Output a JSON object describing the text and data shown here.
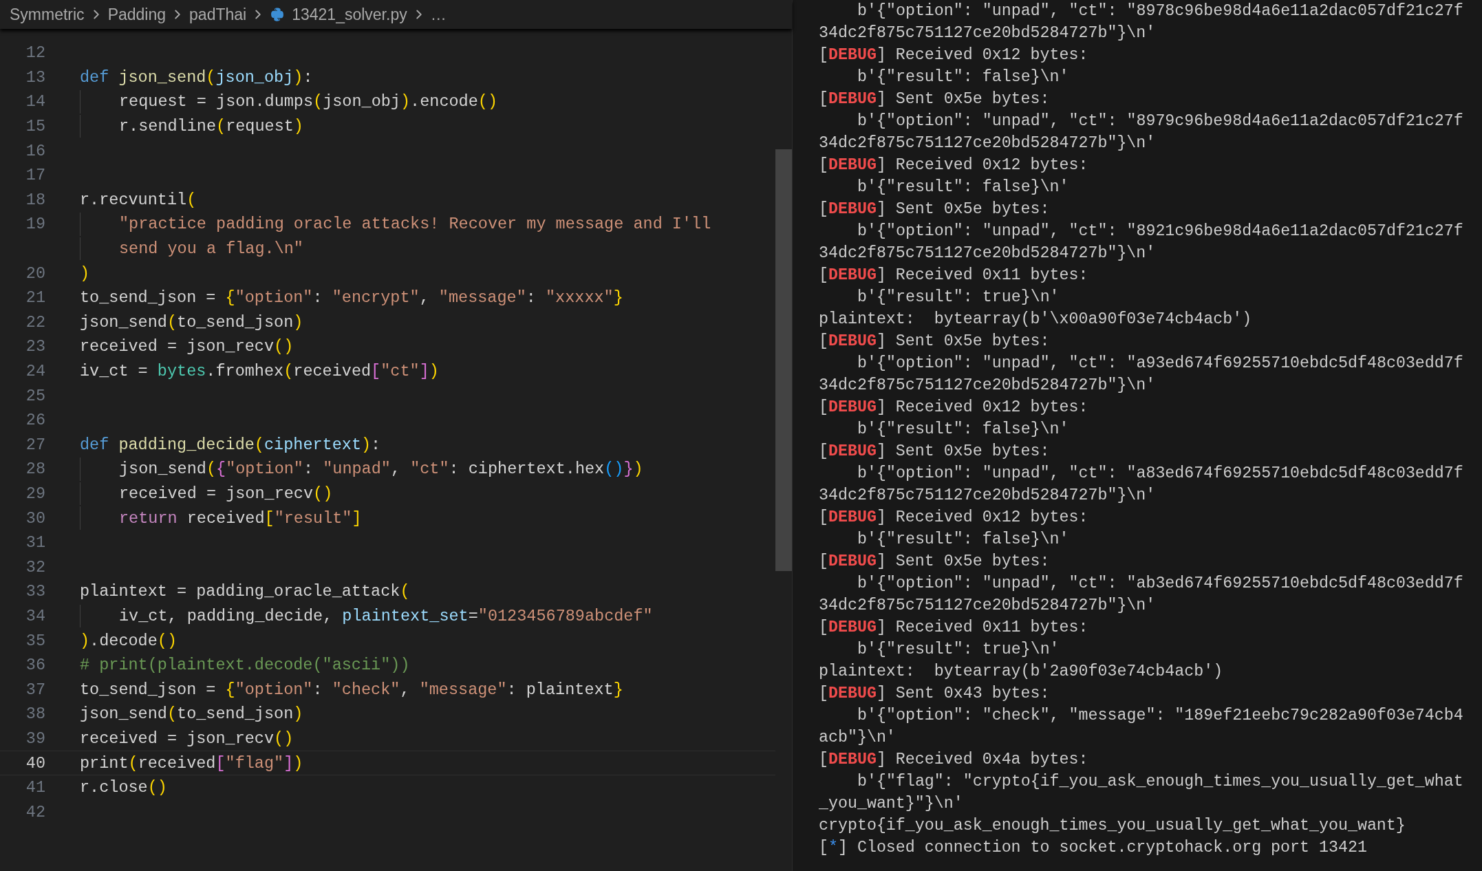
{
  "breadcrumb": [
    {
      "label": "Symmetric",
      "kind": "folder"
    },
    {
      "label": "Padding",
      "kind": "folder"
    },
    {
      "label": "padThai",
      "kind": "folder"
    },
    {
      "label": "13421_solver.py",
      "kind": "file"
    },
    {
      "label": "…",
      "kind": "more"
    }
  ],
  "code": [
    {
      "number": "12",
      "current": false
    },
    {
      "number": "13",
      "current": false,
      "tokens": [
        {
          "text": "def",
          "kind": "kw"
        },
        {
          "text": " json_send",
          "kind": "fn"
        },
        {
          "text": "(",
          "kind": "b1"
        },
        {
          "text": "json_obj",
          "kind": "par"
        },
        {
          "text": ")",
          "kind": "b1"
        },
        {
          "text": ":",
          "kind": "p"
        }
      ],
      "children": [
        {
          "number": "14",
          "current": false,
          "tokens": [
            {
              "text": "request = json.dumps",
              "kind": "p"
            },
            {
              "text": "(",
              "kind": "b1"
            },
            {
              "text": "json_obj",
              "kind": "p"
            },
            {
              "text": ")",
              "kind": "b1"
            },
            {
              "text": ".encode",
              "kind": "p"
            },
            {
              "text": "()",
              "kind": "b1"
            }
          ]
        },
        {
          "number": "15",
          "current": false,
          "tokens": [
            {
              "text": "r.sendline",
              "kind": "p"
            },
            {
              "text": "(",
              "kind": "b1"
            },
            {
              "text": "request",
              "kind": "p"
            },
            {
              "text": ")",
              "kind": "b1"
            }
          ]
        }
      ]
    },
    {
      "number": "16",
      "current": false
    },
    {
      "number": "17",
      "current": false
    },
    {
      "number": "18",
      "current": false,
      "tokens": [
        {
          "text": "r.recvuntil",
          "kind": "p"
        },
        {
          "text": "(",
          "kind": "b1"
        }
      ],
      "children": [
        {
          "number": "19",
          "current": false,
          "tokens": [
            {
              "text": "\"practice padding oracle attacks! Recover my message and I'll",
              "kind": "str"
            }
          ],
          "wrap": [
            {
              "text": "send you a flag.\\n\"",
              "kind": "str"
            }
          ]
        }
      ]
    },
    {
      "number": "20",
      "current": false,
      "tokens": [
        {
          "text": ")",
          "kind": "b1"
        }
      ]
    },
    {
      "number": "21",
      "current": false,
      "tokens": [
        {
          "text": "to_send_json = ",
          "kind": "p"
        },
        {
          "text": "{",
          "kind": "b1"
        },
        {
          "text": "\"option\"",
          "kind": "str"
        },
        {
          "text": ": ",
          "kind": "p"
        },
        {
          "text": "\"encrypt\"",
          "kind": "str"
        },
        {
          "text": ", ",
          "kind": "p"
        },
        {
          "text": "\"message\"",
          "kind": "str"
        },
        {
          "text": ": ",
          "kind": "p"
        },
        {
          "text": "\"xxxxx\"",
          "kind": "str"
        },
        {
          "text": "}",
          "kind": "b1"
        }
      ]
    },
    {
      "number": "22",
      "current": false,
      "tokens": [
        {
          "text": "json_send",
          "kind": "p"
        },
        {
          "text": "(",
          "kind": "b1"
        },
        {
          "text": "to_send_json",
          "kind": "p"
        },
        {
          "text": ")",
          "kind": "b1"
        }
      ]
    },
    {
      "number": "23",
      "current": false,
      "tokens": [
        {
          "text": "received = json_recv",
          "kind": "p"
        },
        {
          "text": "()",
          "kind": "b1"
        }
      ]
    },
    {
      "number": "24",
      "current": false,
      "tokens": [
        {
          "text": "iv_ct = ",
          "kind": "p"
        },
        {
          "text": "bytes",
          "kind": "bi"
        },
        {
          "text": ".fromhex",
          "kind": "p"
        },
        {
          "text": "(",
          "kind": "b1"
        },
        {
          "text": "received",
          "kind": "p"
        },
        {
          "text": "[",
          "kind": "b2"
        },
        {
          "text": "\"ct\"",
          "kind": "str"
        },
        {
          "text": "]",
          "kind": "b2"
        },
        {
          "text": ")",
          "kind": "b1"
        }
      ]
    },
    {
      "number": "25",
      "current": false
    },
    {
      "number": "26",
      "current": false
    },
    {
      "number": "27",
      "current": false,
      "tokens": [
        {
          "text": "def",
          "kind": "kw"
        },
        {
          "text": " padding_decide",
          "kind": "fn"
        },
        {
          "text": "(",
          "kind": "b1"
        },
        {
          "text": "ciphertext",
          "kind": "par"
        },
        {
          "text": ")",
          "kind": "b1"
        },
        {
          "text": ":",
          "kind": "p"
        }
      ],
      "children": [
        {
          "number": "28",
          "current": false,
          "tokens": [
            {
              "text": "json_send",
              "kind": "p"
            },
            {
              "text": "(",
              "kind": "b1"
            },
            {
              "text": "{",
              "kind": "b2"
            },
            {
              "text": "\"option\"",
              "kind": "str"
            },
            {
              "text": ": ",
              "kind": "p"
            },
            {
              "text": "\"unpad\"",
              "kind": "str"
            },
            {
              "text": ", ",
              "kind": "p"
            },
            {
              "text": "\"ct\"",
              "kind": "str"
            },
            {
              "text": ": ciphertext.hex",
              "kind": "p"
            },
            {
              "text": "()",
              "kind": "b3"
            },
            {
              "text": "}",
              "kind": "b2"
            },
            {
              "text": ")",
              "kind": "b1"
            }
          ]
        },
        {
          "number": "29",
          "current": false,
          "tokens": [
            {
              "text": "received = json_recv",
              "kind": "p"
            },
            {
              "text": "()",
              "kind": "b1"
            }
          ]
        },
        {
          "number": "30",
          "current": false,
          "tokens": [
            {
              "text": "return",
              "kind": "ctl"
            },
            {
              "text": " received",
              "kind": "p"
            },
            {
              "text": "[",
              "kind": "b1"
            },
            {
              "text": "\"result\"",
              "kind": "str"
            },
            {
              "text": "]",
              "kind": "b1"
            }
          ]
        }
      ]
    },
    {
      "number": "31",
      "current": false
    },
    {
      "number": "32",
      "current": false
    },
    {
      "number": "33",
      "current": false,
      "tokens": [
        {
          "text": "plaintext = padding_oracle_attack",
          "kind": "p"
        },
        {
          "text": "(",
          "kind": "b1"
        }
      ],
      "children": [
        {
          "number": "34",
          "current": false,
          "tokens": [
            {
              "text": "iv_ct, padding_decide, ",
              "kind": "p"
            },
            {
              "text": "plaintext_set",
              "kind": "par"
            },
            {
              "text": "=",
              "kind": "p"
            },
            {
              "text": "\"0123456789abcdef\"",
              "kind": "str"
            }
          ]
        }
      ]
    },
    {
      "number": "35",
      "current": false,
      "tokens": [
        {
          "text": ")",
          "kind": "b1"
        },
        {
          "text": ".decode",
          "kind": "p"
        },
        {
          "text": "()",
          "kind": "b1"
        }
      ]
    },
    {
      "number": "36",
      "current": false,
      "tokens": [
        {
          "text": "# print(plaintext.decode(\"ascii\"))",
          "kind": "cm"
        }
      ]
    },
    {
      "number": "37",
      "current": false,
      "tokens": [
        {
          "text": "to_send_json = ",
          "kind": "p"
        },
        {
          "text": "{",
          "kind": "b1"
        },
        {
          "text": "\"option\"",
          "kind": "str"
        },
        {
          "text": ": ",
          "kind": "p"
        },
        {
          "text": "\"check\"",
          "kind": "str"
        },
        {
          "text": ", ",
          "kind": "p"
        },
        {
          "text": "\"message\"",
          "kind": "str"
        },
        {
          "text": ": plaintext",
          "kind": "p"
        },
        {
          "text": "}",
          "kind": "b1"
        }
      ]
    },
    {
      "number": "38",
      "current": false,
      "tokens": [
        {
          "text": "json_send",
          "kind": "p"
        },
        {
          "text": "(",
          "kind": "b1"
        },
        {
          "text": "to_send_json",
          "kind": "p"
        },
        {
          "text": ")",
          "kind": "b1"
        }
      ]
    },
    {
      "number": "39",
      "current": false,
      "tokens": [
        {
          "text": "received = json_recv",
          "kind": "p"
        },
        {
          "text": "()",
          "kind": "b1"
        }
      ]
    },
    {
      "number": "40",
      "current": true,
      "tokens": [
        {
          "text": "print",
          "kind": "p"
        },
        {
          "text": "(",
          "kind": "b1"
        },
        {
          "text": "received",
          "kind": "p"
        },
        {
          "text": "[",
          "kind": "b2"
        },
        {
          "text": "\"flag\"",
          "kind": "str"
        },
        {
          "text": "]",
          "kind": "b2"
        },
        {
          "text": ")",
          "kind": "b1"
        }
      ]
    },
    {
      "number": "41",
      "current": false,
      "tokens": [
        {
          "text": "r.close",
          "kind": "p"
        },
        {
          "text": "()",
          "kind": "b1"
        }
      ]
    },
    {
      "number": "42",
      "current": false
    }
  ],
  "terminal": [
    {
      "kind": "data",
      "parts": [
        "b'{\"option\": \"unpad\", \"ct\": \"8978c96be98d4a6e11a2dac057df21c27f"
      ]
    },
    {
      "kind": "wrap",
      "parts": [
        "34dc2f875c751127ce20bd5284727b\"}\\n'"
      ]
    },
    {
      "kind": "debug",
      "parts": [
        "[",
        "DEBUG",
        "] Received 0x12 bytes:"
      ]
    },
    {
      "kind": "data",
      "parts": [
        "b'{\"result\": false}\\n'"
      ]
    },
    {
      "kind": "debug",
      "parts": [
        "[",
        "DEBUG",
        "] Sent 0x5e bytes:"
      ]
    },
    {
      "kind": "data",
      "parts": [
        "b'{\"option\": \"unpad\", \"ct\": \"8979c96be98d4a6e11a2dac057df21c27f"
      ]
    },
    {
      "kind": "wrap",
      "parts": [
        "34dc2f875c751127ce20bd5284727b\"}\\n'"
      ]
    },
    {
      "kind": "debug",
      "parts": [
        "[",
        "DEBUG",
        "] Received 0x12 bytes:"
      ]
    },
    {
      "kind": "data",
      "parts": [
        "b'{\"result\": false}\\n'"
      ]
    },
    {
      "kind": "debug",
      "parts": [
        "[",
        "DEBUG",
        "] Sent 0x5e bytes:"
      ]
    },
    {
      "kind": "data",
      "parts": [
        "b'{\"option\": \"unpad\", \"ct\": \"8921c96be98d4a6e11a2dac057df21c27f"
      ]
    },
    {
      "kind": "wrap",
      "parts": [
        "34dc2f875c751127ce20bd5284727b\"}\\n'"
      ]
    },
    {
      "kind": "debug",
      "parts": [
        "[",
        "DEBUG",
        "] Received 0x11 bytes:"
      ]
    },
    {
      "kind": "data",
      "parts": [
        "b'{\"result\": true}\\n'"
      ]
    },
    {
      "kind": "plain",
      "parts": [
        "plaintext:  bytearray(b'\\x00a90f03e74cb4acb')"
      ]
    },
    {
      "kind": "debug",
      "parts": [
        "[",
        "DEBUG",
        "] Sent 0x5e bytes:"
      ]
    },
    {
      "kind": "data",
      "parts": [
        "b'{\"option\": \"unpad\", \"ct\": \"a93ed674f69255710ebdc5df48c03edd7f"
      ]
    },
    {
      "kind": "wrap",
      "parts": [
        "34dc2f875c751127ce20bd5284727b\"}\\n'"
      ]
    },
    {
      "kind": "debug",
      "parts": [
        "[",
        "DEBUG",
        "] Received 0x12 bytes:"
      ]
    },
    {
      "kind": "data",
      "parts": [
        "b'{\"result\": false}\\n'"
      ]
    },
    {
      "kind": "debug",
      "parts": [
        "[",
        "DEBUG",
        "] Sent 0x5e bytes:"
      ]
    },
    {
      "kind": "data",
      "parts": [
        "b'{\"option\": \"unpad\", \"ct\": \"a83ed674f69255710ebdc5df48c03edd7f"
      ]
    },
    {
      "kind": "wrap",
      "parts": [
        "34dc2f875c751127ce20bd5284727b\"}\\n'"
      ]
    },
    {
      "kind": "debug",
      "parts": [
        "[",
        "DEBUG",
        "] Received 0x12 bytes:"
      ]
    },
    {
      "kind": "data",
      "parts": [
        "b'{\"result\": false}\\n'"
      ]
    },
    {
      "kind": "debug",
      "parts": [
        "[",
        "DEBUG",
        "] Sent 0x5e bytes:"
      ]
    },
    {
      "kind": "data",
      "parts": [
        "b'{\"option\": \"unpad\", \"ct\": \"ab3ed674f69255710ebdc5df48c03edd7f"
      ]
    },
    {
      "kind": "wrap",
      "parts": [
        "34dc2f875c751127ce20bd5284727b\"}\\n'"
      ]
    },
    {
      "kind": "debug",
      "parts": [
        "[",
        "DEBUG",
        "] Received 0x11 bytes:"
      ]
    },
    {
      "kind": "data",
      "parts": [
        "b'{\"result\": true}\\n'"
      ]
    },
    {
      "kind": "plain",
      "parts": [
        "plaintext:  bytearray(b'2a90f03e74cb4acb')"
      ]
    },
    {
      "kind": "debug",
      "parts": [
        "[",
        "DEBUG",
        "] Sent 0x43 bytes:"
      ]
    },
    {
      "kind": "data",
      "parts": [
        "b'{\"option\": \"check\", \"message\": \"189ef21eebc79c282a90f03e74cb4"
      ]
    },
    {
      "kind": "wrap",
      "parts": [
        "acb\"}\\n'"
      ]
    },
    {
      "kind": "debug",
      "parts": [
        "[",
        "DEBUG",
        "] Received 0x4a bytes:"
      ]
    },
    {
      "kind": "data",
      "parts": [
        "b'{\"flag\": \"crypto{if_you_ask_enough_times_you_usually_get_what"
      ]
    },
    {
      "kind": "wrap",
      "parts": [
        "_you_want}\"}\\n'"
      ]
    },
    {
      "kind": "plain",
      "parts": [
        "crypto{if_you_ask_enough_times_you_usually_get_what_you_want}"
      ]
    },
    {
      "kind": "info",
      "parts": [
        "[",
        "*",
        "] Closed connection to socket.cryptohack.org port 13421"
      ]
    }
  ]
}
